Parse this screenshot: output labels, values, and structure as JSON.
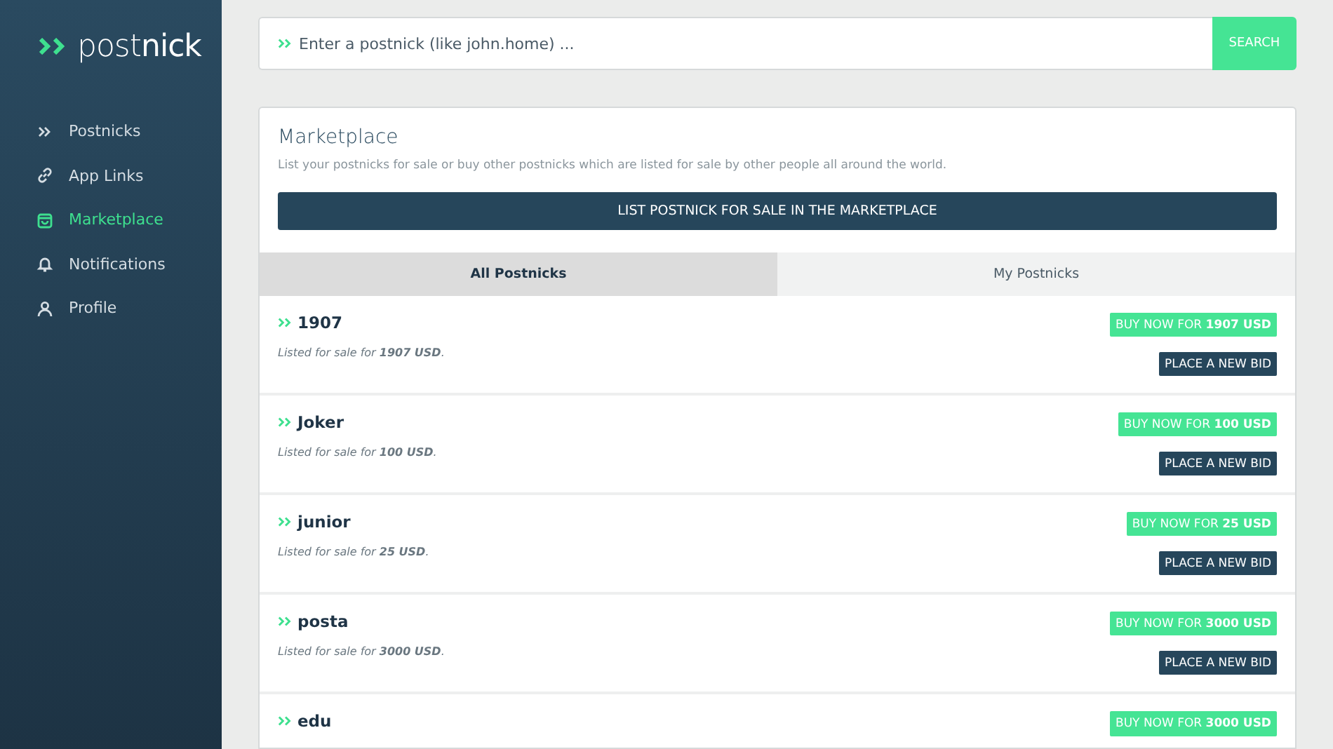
{
  "logo": "post**nick**",
  "nav": [
    {
      "label": "Postnicks",
      "selected": false
    },
    {
      "label": "App Links",
      "selected": false
    },
    {
      "label": "Marketplace",
      "selected": true
    },
    {
      "label": "Notifications",
      "selected": false
    },
    {
      "label": "Profile",
      "selected": false
    }
  ],
  "search": {
    "placeholder": "Enter a postnick (like john.home) ...",
    "button": "SEARCH"
  },
  "marketplace": {
    "title": "Marketplace",
    "description": "List your postnicks for sale or buy other postnicks which are listed for sale by other people all around the world.",
    "list_button": "LIST POSTNICK FOR SALE IN THE MARKETPLACE",
    "tabs": [
      {
        "label": "All Postnicks",
        "selected": true
      },
      {
        "label": "My Postnicks",
        "selected": false
      }
    ],
    "listings": [
      {
        "name": "1907",
        "listed": "Listed for sale for **1907 USD**.",
        "buy": "BUY NOW FOR **1907 USD**",
        "bid": "PLACE A NEW BID"
      },
      {
        "name": "Joker",
        "listed": "Listed for sale for **100 USD**.",
        "buy": "BUY NOW FOR **100 USD**",
        "bid": "PLACE A NEW BID"
      },
      {
        "name": "junior",
        "listed": "Listed for sale for **25 USD**.",
        "buy": "BUY NOW FOR **25 USD**",
        "bid": "PLACE A NEW BID"
      },
      {
        "name": "posta",
        "listed": "Listed for sale for **3000 USD**.",
        "buy": "BUY NOW FOR **3000 USD**",
        "bid": "PLACE A NEW BID"
      },
      {
        "name": "edu",
        "buy": "BUY NOW FOR **3000 USD**"
      }
    ]
  }
}
